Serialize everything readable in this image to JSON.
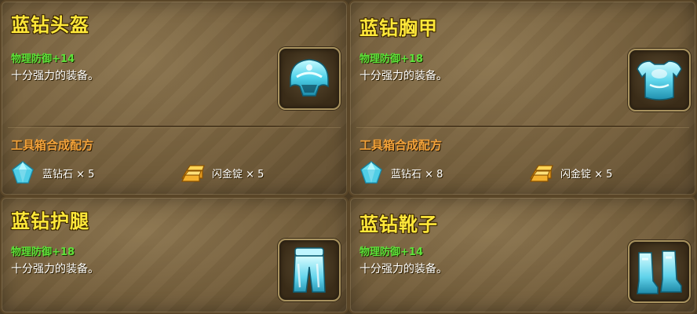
{
  "cards": [
    {
      "title": "蓝钻头盔",
      "stat": "物理防御+14",
      "desc": "十分强力的装备。",
      "icon": "helmet-icon",
      "recipe_title": "工具箱合成配方",
      "materials": [
        {
          "icon": "blue-diamond-icon",
          "text": "蓝钻石 × 5"
        },
        {
          "icon": "gold-ingot-icon",
          "text": "闪金锭 × 5"
        }
      ]
    },
    {
      "title": "蓝钻胸甲",
      "stat": "物理防御+18",
      "desc": "十分强力的装备。",
      "icon": "chest-armor-icon",
      "recipe_title": "工具箱合成配方",
      "materials": [
        {
          "icon": "blue-diamond-icon",
          "text": "蓝钻石 × 8"
        },
        {
          "icon": "gold-ingot-icon",
          "text": "闪金锭 × 5"
        }
      ]
    },
    {
      "title": "蓝钻护腿",
      "stat": "物理防御+18",
      "desc": "十分强力的装备。",
      "icon": "leggings-icon"
    },
    {
      "title": "蓝钻靴子",
      "stat": "物理防御+14",
      "desc": "十分强力的装备。",
      "icon": "boots-icon"
    }
  ],
  "colors": {
    "title": "#ffe83a",
    "stat": "#5ee23a",
    "recipe": "#f2a23a",
    "diamond": "#6fe2f2"
  }
}
